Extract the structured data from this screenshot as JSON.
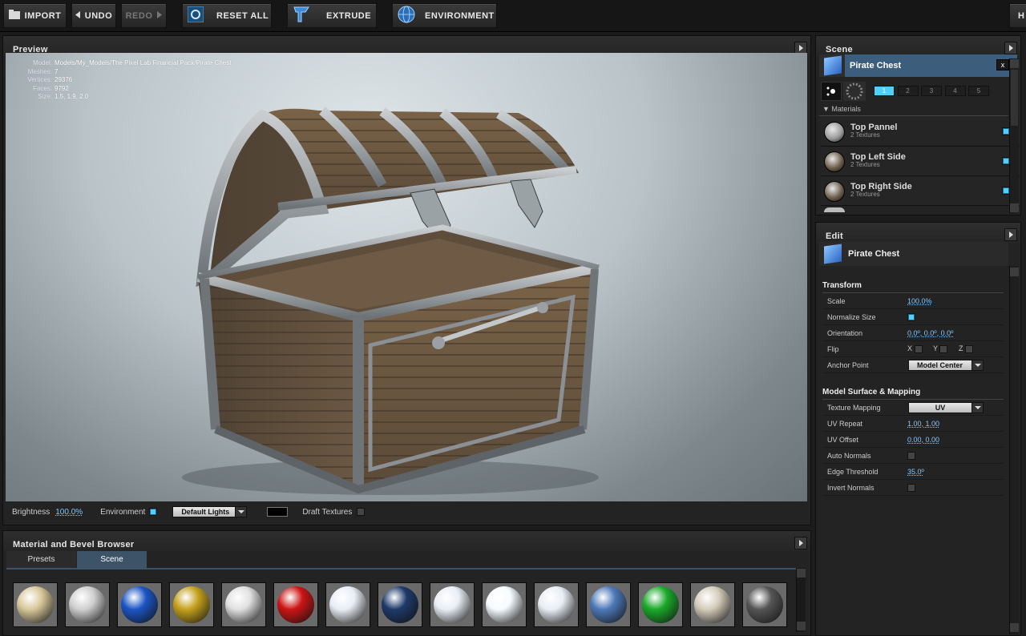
{
  "toolbar": {
    "import": "IMPORT",
    "undo": "UNDO",
    "redo": "REDO",
    "reset_all": "RESET ALL",
    "extrude": "EXTRUDE",
    "environment": "ENVIRONMENT",
    "right_edge": "H"
  },
  "preview": {
    "title": "Preview",
    "info": {
      "model_k": "Model:",
      "model_v": "Models/My_Models/The Pixel Lab Financial Pack/Pirate Chest",
      "meshes_k": "Meshes:",
      "meshes_v": "7",
      "vertices_k": "Vertices:",
      "vertices_v": "29376",
      "faces_k": "Faces:",
      "faces_v": "9792",
      "size_k": "Size:",
      "size_v": "1.5, 1.9, 2.0"
    },
    "status": {
      "brightness_label": "Brightness",
      "brightness_value": "100.0%",
      "environment_label": "Environment",
      "lights_select": "Default Lights",
      "draft_label": "Draft Textures"
    }
  },
  "browser": {
    "title": "Material and Bevel Browser",
    "tabs": [
      "Presets",
      "Scene"
    ],
    "active_tab": "Scene",
    "thumb_colors": [
      "#d8c89a",
      "#cfcfcf",
      "#1b55c4",
      "#c4a11c",
      "#e0e0e0",
      "#cc1515",
      "#e8eef5",
      "#1e3a6a",
      "#e8eef5",
      "#f4fbff",
      "#e8eef5",
      "#4d79b8",
      "#1aa92a",
      "#d4ccba",
      "#555555"
    ],
    "thumb_names": [
      "glow-sphere",
      "chrome-sphere",
      "blue-sphere",
      "gold-sphere",
      "striped-sphere",
      "red-sphere",
      "text-sphere",
      "navy-sphere",
      "text-sphere",
      "white-sphere",
      "text-sphere",
      "logo-sphere",
      "green-sphere",
      "wood-sphere",
      "dark-sphere"
    ]
  },
  "scene": {
    "title": "Scene",
    "object_name": "Pirate Chest",
    "close": "x",
    "tabs": [
      "1",
      "2",
      "3",
      "4",
      "5"
    ],
    "materials_header": "Materials",
    "materials": [
      {
        "name": "Top Pannel",
        "sub": "2 Textures"
      },
      {
        "name": "Top Left Side",
        "sub": "2 Textures"
      },
      {
        "name": "Top Right Side",
        "sub": "2 Textures"
      }
    ]
  },
  "edit": {
    "title": "Edit",
    "object_name": "Pirate Chest",
    "transform_header": "Transform",
    "scale_label": "Scale",
    "scale_value": "100.0%",
    "normalize_label": "Normalize Size",
    "orientation_label": "Orientation",
    "orientation_value": "0.0º, 0.0º, 0.0º",
    "flip_label": "Flip",
    "flip_x": "X",
    "flip_y": "Y",
    "flip_z": "Z",
    "anchor_label": "Anchor Point",
    "anchor_value": "Model Center",
    "surface_header": "Model Surface & Mapping",
    "texmap_label": "Texture Mapping",
    "texmap_value": "UV",
    "uvrepeat_label": "UV Repeat",
    "uvrepeat_value": "1.00, 1.00",
    "uvoffset_label": "UV Offset",
    "uvoffset_value": "0.00, 0.00",
    "autonormals_label": "Auto Normals",
    "edge_label": "Edge Threshold",
    "edge_value": "35.0º",
    "invert_label": "Invert Normals"
  }
}
